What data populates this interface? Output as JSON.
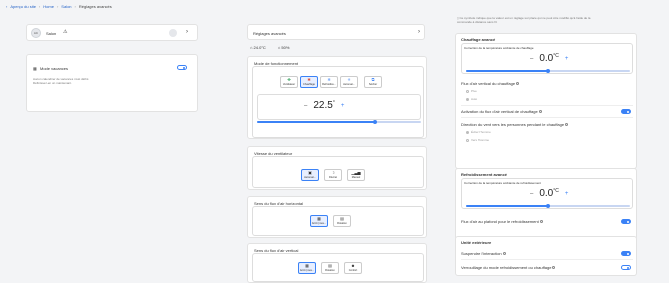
{
  "breadcrumb": {
    "back_icon": "chevron-left-icon",
    "items": [
      "Aperçu du site",
      "Home",
      "Salon",
      "Réglages avancés"
    ]
  },
  "left": {
    "room_name": "Salon",
    "vacation": {
      "title": "Mode vacances",
      "desc_line1": "Aucun calendrier de vacances n'est défini.",
      "desc_line2": "Définissez-en un maintenant."
    }
  },
  "middle": {
    "advanced_settings_label": "Réglages avancés",
    "indoor_temp": "24.0°C",
    "humidity": "50%",
    "mode": {
      "title": "Mode de fonctionnement",
      "buttons": [
        {
          "label": "Ventilateur",
          "icon": "fan-icon"
        },
        {
          "label": "Chauffage",
          "icon": "flame-icon"
        },
        {
          "label": "Refroidiss...",
          "icon": "snowflake-icon"
        },
        {
          "label": "Automat...",
          "icon": "auto-icon"
        },
        {
          "label": "Sécher",
          "icon": "drop-icon"
        }
      ],
      "selected": 1,
      "setpoint_value": "22.5",
      "setpoint_unit": "°",
      "slider_level": 0.72
    },
    "fan_speed": {
      "title": "Vitesse du ventilateur",
      "buttons": [
        {
          "label": "Automat...",
          "icon": "auto-icon"
        },
        {
          "label": "Discret",
          "icon": "quiet-icon"
        },
        {
          "label": "Manuel",
          "icon": "bars-icon"
        }
      ],
      "selected": 0
    },
    "horizontal": {
      "title": "Sens du flux d'air horizontal",
      "buttons": [
        {
          "label": "Arrêt (mes...",
          "icon": "grid-icon"
        },
        {
          "label": "Rotation",
          "icon": "grid-icon"
        }
      ],
      "selected": 0
    },
    "vertical": {
      "title": "Sens du flux d'air vertical",
      "buttons": [
        {
          "label": "Arrêt (mes...",
          "icon": "grid-icon"
        },
        {
          "label": "Rotation",
          "icon": "grid-icon"
        },
        {
          "label": "Confort",
          "icon": "person-icon"
        }
      ],
      "selected": 0
    }
  },
  "right": {
    "note_line1": "Ce symbole indique que la valeur est un réglage sur place qui ne peut être modifié qu'à l'aide de la",
    "note_line2": "commande à distance sans fil.",
    "heating": {
      "title": "Chauffage avancé",
      "correction_label": "Correction de la température ambiante de chauffage",
      "value": "0.0",
      "unit": "°C",
      "slider_level": 0.5,
      "vertical_flow_label": "Flux d'air vertical du chauffage",
      "radio1": "Pive",
      "radio2": "Auto",
      "activation_label": "Activation du flux d'air vertical de chauffage",
      "direction_label": "Direction du vent vers les personnes pendant le chauffage",
      "dir_radio1": "Éviter l'homme",
      "dir_radio2": "Vers l'homme"
    },
    "cooling": {
      "title": "Refroidissement avancé",
      "correction_label": "Correction de la température ambiante de refroidissement",
      "value": "0.0",
      "unit": "°C",
      "slider_level": 0.5,
      "ceiling_flow_label": "Flux d'air au plafond pour le refroidissement"
    },
    "outdoor": {
      "title": "Unité extérieure",
      "suspend_label": "Suspendre l'interaction",
      "lock_label": "Verrouillage du mode refroidissement ou chauffage"
    }
  },
  "colors": {
    "accent": "#3b82f6",
    "link": "#2563c7"
  }
}
